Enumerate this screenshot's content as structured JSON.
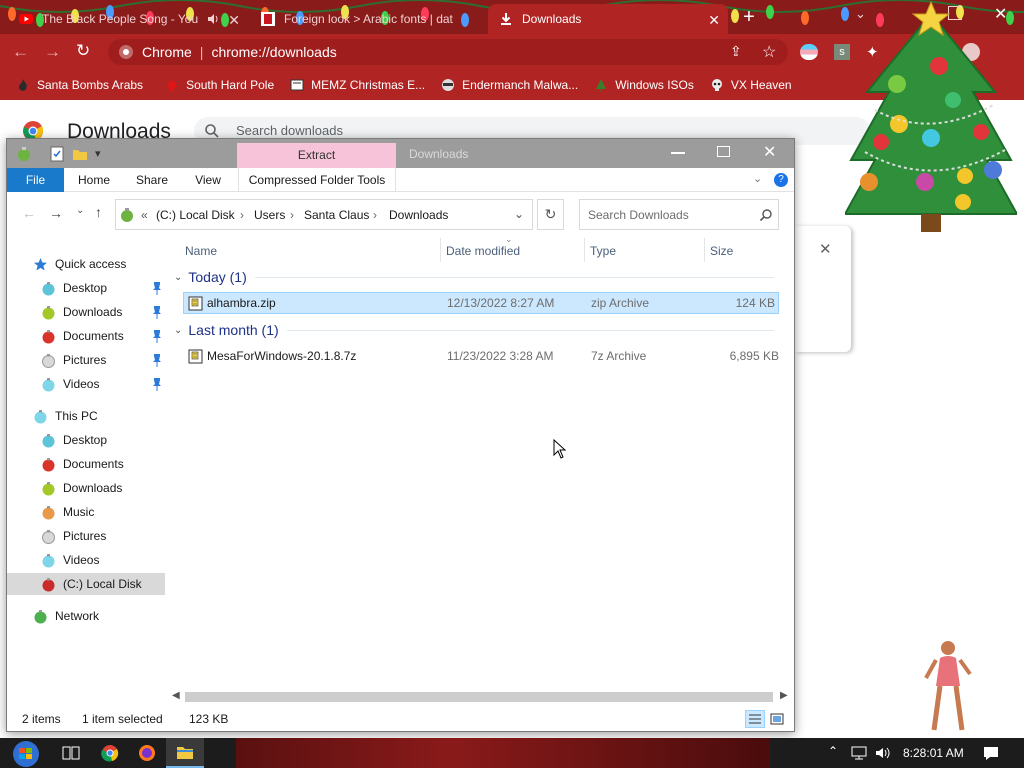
{
  "chrome": {
    "tabs": [
      {
        "title": "The Black People Song - You",
        "favicon": "youtube-icon",
        "active": false
      },
      {
        "title": "Foreign look > Arabic fonts | dat",
        "favicon": "dafont-icon",
        "active": false
      },
      {
        "title": "Downloads",
        "favicon": "download-icon",
        "active": true
      }
    ],
    "omnibox": {
      "site": "Chrome",
      "url": "chrome://downloads"
    },
    "bookmarks": [
      {
        "label": "Santa Bombs Arabs",
        "icon": "flame-icon"
      },
      {
        "label": "South Hard Pole",
        "icon": "maple-leaf-icon"
      },
      {
        "label": "MEMZ Christmas E...",
        "icon": "document-icon"
      },
      {
        "label": "Endermanch Malwa...",
        "icon": "raccoon-icon"
      },
      {
        "label": "Windows ISOs",
        "icon": "christmas-tree-icon"
      },
      {
        "label": "VX Heaven",
        "icon": "skull-icon"
      }
    ],
    "downloads_page": {
      "title": "Downloads",
      "search_placeholder": "Search downloads"
    }
  },
  "explorer": {
    "title": "Downloads",
    "context_tab": "Extract",
    "ribbon_tabs": [
      "File",
      "Home",
      "Share",
      "View",
      "Compressed Folder Tools"
    ],
    "breadcrumb": [
      "(C:) Local Disk",
      "Users",
      "Santa Claus",
      "Downloads"
    ],
    "search_placeholder": "Search Downloads",
    "columns": {
      "name": "Name",
      "date": "Date modified",
      "type": "Type",
      "size": "Size"
    },
    "groups": [
      {
        "label": "Today (1)",
        "files": [
          {
            "name": "alhambra.zip",
            "date": "12/13/2022 8:27 AM",
            "type": "zip Archive",
            "size": "124 KB",
            "selected": true
          }
        ]
      },
      {
        "label": "Last month (1)",
        "files": [
          {
            "name": "MesaForWindows-20.1.8.7z",
            "date": "11/23/2022 3:28 AM",
            "type": "7z Archive",
            "size": "6,895 KB",
            "selected": false
          }
        ]
      }
    ],
    "nav": {
      "quick_access": "Quick access",
      "quick_items": [
        "Desktop",
        "Downloads",
        "Documents",
        "Pictures",
        "Videos"
      ],
      "this_pc": "This PC",
      "pc_items": [
        "Desktop",
        "Documents",
        "Downloads",
        "Music",
        "Pictures",
        "Videos",
        "(C:) Local Disk"
      ],
      "network": "Network"
    },
    "status": {
      "items": "2 items",
      "selected": "1 item selected",
      "size": "123 KB"
    }
  },
  "taskbar": {
    "time": "8:28:01 AM"
  },
  "colors": {
    "chrome_frame": "#b02424",
    "selection": "#cce8ff",
    "selection_border": "#99d1ff",
    "taskbar": "#1c1c1c"
  }
}
